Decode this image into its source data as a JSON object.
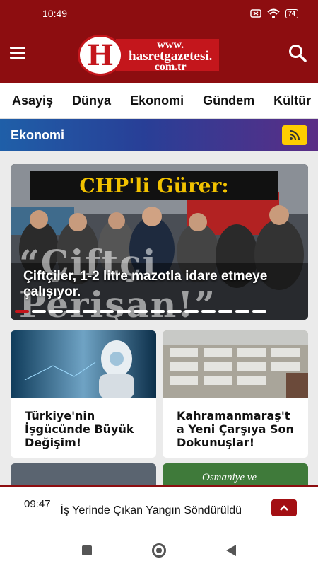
{
  "status": {
    "time": "10:49",
    "battery": "74"
  },
  "header": {
    "logo_line1": "www.",
    "logo_line2": "hasretgazetesi.",
    "logo_line3": "com.tr",
    "logo_mark": "H"
  },
  "nav": {
    "items": [
      "Asayiş",
      "Dünya",
      "Ekonomi",
      "Gündem",
      "Kültür"
    ]
  },
  "section": {
    "title": "Ekonomi"
  },
  "hero": {
    "banner_text": "CHP'li Gürer:",
    "overlay_quote": "“Çiftçi Perişan!”",
    "caption": "Çiftçiler, 1-2 litre mazotla idare etmeye çalışıyor.",
    "slide_count": 15,
    "active_slide": 1
  },
  "cards": [
    {
      "title": "Türkiye'nin İşgücünde Büyük Değişim!"
    },
    {
      "title": "Kahramanmaraş't a Yeni Çarşıya Son Dokunuşlar!"
    }
  ],
  "peek": {
    "right_text": "Osmaniye ve"
  },
  "ticker": {
    "time": "09:47",
    "text": "İş Yerinde Çıkan Yangın Söndürüldü"
  }
}
